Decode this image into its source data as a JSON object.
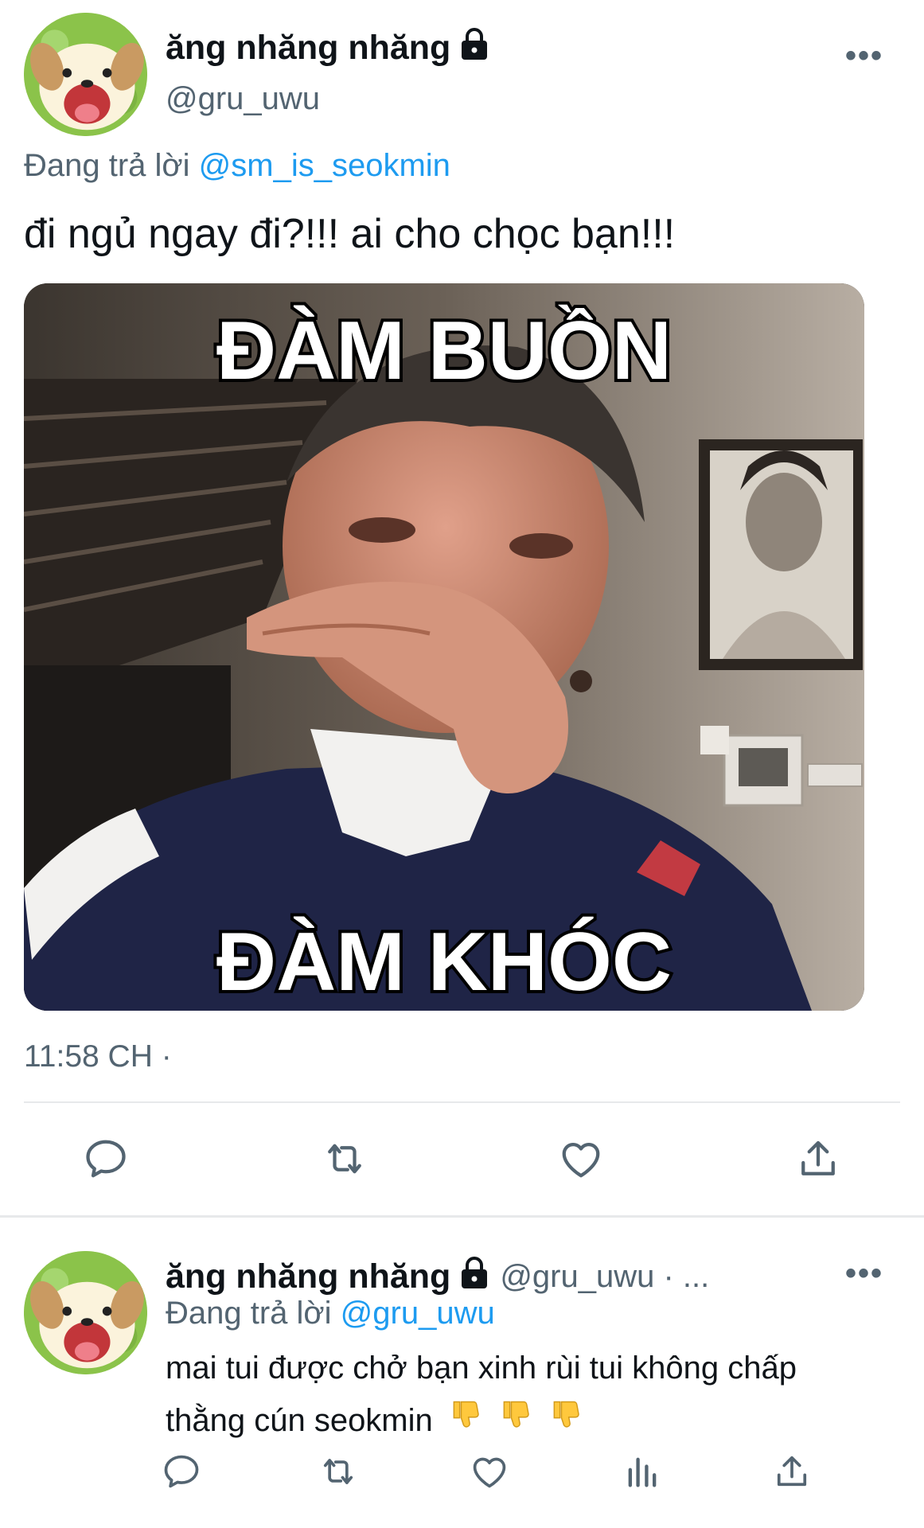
{
  "tweet": {
    "display_name": "ăng nhăng nhăng",
    "handle": "@gru_uwu",
    "reply_prefix": "Đang trả lời",
    "reply_mention": "@sm_is_seokmin",
    "text": "đi ngủ ngay đi?!!! ai cho chọc bạn!!!",
    "media": {
      "caption_top": "ĐÀM BUỒN",
      "caption_bottom": "ĐÀM KHÓC"
    },
    "timestamp": "11:58 CH ·",
    "more_label": "•••"
  },
  "actions": [
    {
      "icon": "reply-icon"
    },
    {
      "icon": "retweet-icon"
    },
    {
      "icon": "like-icon"
    },
    {
      "icon": "share-icon"
    }
  ],
  "reply": {
    "display_name": "ăng nhăng nhăng",
    "handle_meta": "@gru_uwu · ...",
    "reply_prefix": "Đang trả lời",
    "reply_mention": "@gru_uwu",
    "text_line1": "mai tui được chở bạn xinh rùi tui không chấp",
    "text_line2": "thằng cún seokmin",
    "more_label": "•••"
  },
  "reply_actions": [
    {
      "icon": "reply-icon"
    },
    {
      "icon": "retweet-icon"
    },
    {
      "icon": "like-icon"
    },
    {
      "icon": "analytics-icon"
    },
    {
      "icon": "share-icon"
    }
  ],
  "colors": {
    "accent": "#1d9bf0",
    "secondary_text": "#536471",
    "primary_text": "#0f1419",
    "divider": "#e7e9eb"
  }
}
